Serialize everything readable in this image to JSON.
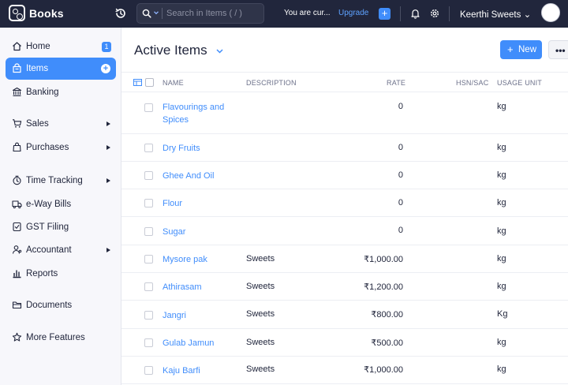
{
  "topbar": {
    "app_name": "Books",
    "search_placeholder": "Search in Items ( / )",
    "trial_text": "You are cur...",
    "upgrade_label": "Upgrade",
    "quick_create": "+",
    "org_name": "Keerthi Sweets",
    "org_caret": "⌄"
  },
  "sidebar": {
    "items": [
      {
        "label": "Home",
        "icon": "home-icon",
        "badge": "1"
      },
      {
        "label": "Items",
        "icon": "items-icon",
        "plus": "+"
      },
      {
        "label": "Banking",
        "icon": "bank-icon"
      },
      {
        "label": "Sales",
        "icon": "cart-icon"
      },
      {
        "label": "Purchases",
        "icon": "bag-icon"
      },
      {
        "label": "Time Tracking",
        "icon": "timer-icon"
      },
      {
        "label": "e-Way Bills",
        "icon": "truck-icon"
      },
      {
        "label": "GST Filing",
        "icon": "gst-icon"
      },
      {
        "label": "Accountant",
        "icon": "accountant-icon"
      },
      {
        "label": "Reports",
        "icon": "reports-icon"
      },
      {
        "label": "Documents",
        "icon": "folder-icon"
      },
      {
        "label": "More Features",
        "icon": "star-icon"
      }
    ]
  },
  "main": {
    "title": "Active Items",
    "new_label": "New",
    "new_plus": "+",
    "more_label": "•••",
    "columns": {
      "name": "NAME",
      "description": "DESCRIPTION",
      "rate": "RATE",
      "hsn": "HSN/SAC",
      "unit": "USAGE UNIT"
    },
    "rows": [
      {
        "name": "Flavourings and Spices",
        "description": "",
        "rate": "0",
        "hsn": "",
        "unit": "kg"
      },
      {
        "name": "Dry Fruits",
        "description": "",
        "rate": "0",
        "hsn": "",
        "unit": "kg"
      },
      {
        "name": "Ghee And Oil",
        "description": "",
        "rate": "0",
        "hsn": "",
        "unit": "kg"
      },
      {
        "name": "Flour",
        "description": "",
        "rate": "0",
        "hsn": "",
        "unit": "kg"
      },
      {
        "name": "Sugar",
        "description": "",
        "rate": "0",
        "hsn": "",
        "unit": "kg"
      },
      {
        "name": "Mysore pak",
        "description": "Sweets",
        "rate": "₹1,000.00",
        "hsn": "",
        "unit": "kg"
      },
      {
        "name": "Athirasam",
        "description": "Sweets",
        "rate": "₹1,200.00",
        "hsn": "",
        "unit": "kg"
      },
      {
        "name": "Jangri",
        "description": "Sweets",
        "rate": "₹800.00",
        "hsn": "",
        "unit": "Kg"
      },
      {
        "name": "Gulab Jamun",
        "description": "Sweets",
        "rate": "₹500.00",
        "hsn": "",
        "unit": "kg"
      },
      {
        "name": "Kaju Barfi",
        "description": "Sweets",
        "rate": "₹1,000.00",
        "hsn": "",
        "unit": "kg"
      }
    ]
  },
  "colors": {
    "topbar_bg": "#21263c",
    "accent": "#408dfb",
    "sidebar_bg": "#f7f7fb",
    "link": "#408dfb"
  }
}
